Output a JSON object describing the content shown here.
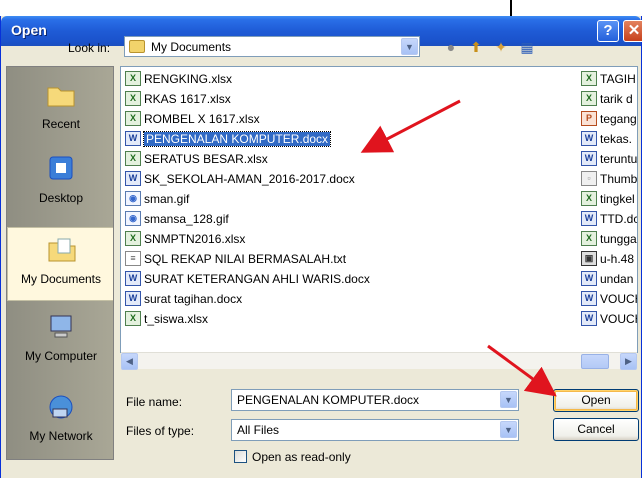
{
  "window": {
    "title": "Open"
  },
  "toolbar": {
    "look_in_label": "Look in:",
    "look_in_value": "My Documents"
  },
  "places": [
    {
      "label": "Recent",
      "icon": "recent-folder-icon"
    },
    {
      "label": "Desktop",
      "icon": "desktop-icon"
    },
    {
      "label": "My Documents",
      "icon": "my-documents-folder-icon",
      "selected": true
    },
    {
      "label": "My Computer",
      "icon": "computer-icon"
    },
    {
      "label": "My Network",
      "icon": "network-icon"
    }
  ],
  "files_col1": [
    {
      "name": "RENGKING.xlsx",
      "type": "xlsx"
    },
    {
      "name": "RKAS 1617.xlsx",
      "type": "xlsx"
    },
    {
      "name": "ROMBEL X 1617.xlsx",
      "type": "xlsx"
    },
    {
      "name": "PENGENALAN KOMPUTER.docx",
      "type": "docx",
      "selected": true
    },
    {
      "name": "SERATUS BESAR.xlsx",
      "type": "xlsx"
    },
    {
      "name": "SK_SEKOLAH-AMAN_2016-2017.docx",
      "type": "docx"
    },
    {
      "name": "sman.gif",
      "type": "gif"
    },
    {
      "name": "smansa_128.gif",
      "type": "gif"
    },
    {
      "name": "SNMPTN2016.xlsx",
      "type": "xlsx"
    },
    {
      "name": "SQL REKAP NILAI BERMASALAH.txt",
      "type": "txt"
    },
    {
      "name": "SURAT KETERANGAN AHLI WARIS.docx",
      "type": "docx"
    },
    {
      "name": "surat tagihan.docx",
      "type": "docx"
    },
    {
      "name": "t_siswa.xlsx",
      "type": "xlsx"
    }
  ],
  "files_col2": [
    {
      "name": "TAGIH",
      "type": "xlsx"
    },
    {
      "name": "tarik d",
      "type": "xlsx"
    },
    {
      "name": "tegang",
      "type": "ppt"
    },
    {
      "name": "tekas.",
      "type": "docx"
    },
    {
      "name": "teruntu",
      "type": "docx"
    },
    {
      "name": "Thumb",
      "type": "thumb"
    },
    {
      "name": "tingkel",
      "type": "xlsx"
    },
    {
      "name": "TTD.dc",
      "type": "docx"
    },
    {
      "name": "tungga",
      "type": "xlsx"
    },
    {
      "name": "u-h.48",
      "type": "misc"
    },
    {
      "name": "undan",
      "type": "docx"
    },
    {
      "name": "VOUCH",
      "type": "docx"
    },
    {
      "name": "VOUCH",
      "type": "docx"
    }
  ],
  "form": {
    "file_name_label": "File name:",
    "file_name_value": "PENGENALAN KOMPUTER.docx",
    "file_type_label": "Files of type:",
    "file_type_value": "All Files",
    "read_only_label": "Open as read-only",
    "read_only_checked": false
  },
  "buttons": {
    "open": "Open",
    "cancel": "Cancel"
  },
  "colors": {
    "title_bar": "#1F5BD6",
    "selection": "#316AC5",
    "annotation_arrow": "#E0141E"
  }
}
